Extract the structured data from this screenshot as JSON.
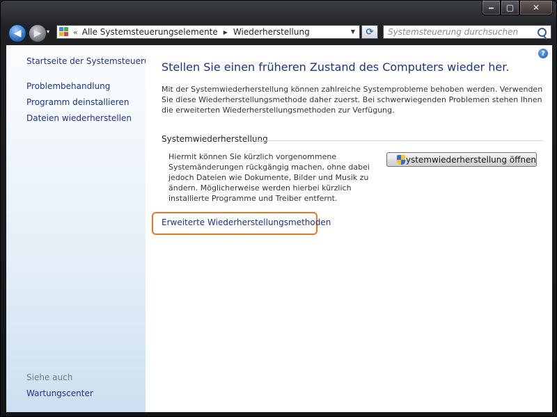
{
  "window": {
    "caption": {
      "minimize": "‒",
      "maximize": "▢",
      "close": "✕"
    }
  },
  "nav": {
    "back_glyph": "◀",
    "forward_glyph": "▶",
    "dropdown_glyph": "▾"
  },
  "address": {
    "overflow": "«",
    "items": [
      "Alle Systemsteuerungselemente",
      "Wiederherstellung"
    ],
    "separator": "▶",
    "dropdown_glyph": "▼"
  },
  "refresh_glyph": "⟳",
  "search": {
    "placeholder": "Systemsteuerung durchsuchen"
  },
  "sidebar": {
    "home": "Startseite der Systemsteuerung",
    "links": [
      "Problembehandlung",
      "Programm deinstallieren",
      "Dateien wiederherstellen"
    ],
    "see_also": "Siehe auch",
    "see_also_links": [
      "Wartungscenter"
    ]
  },
  "main": {
    "help_glyph": "?",
    "heading": "Stellen Sie einen früheren Zustand des Computers wieder her.",
    "intro": "Mit der Systemwiederherstellung können zahlreiche Systemprobleme behoben werden. Verwenden Sie diese Wiederherstellungsmethode daher zuerst. Bei schwerwiegenden Problemen stehen Ihnen die erweiterten Wiederherstellungsmethoden zur Verfügung.",
    "section_title": "Systemwiederherstellung",
    "section_desc": "Hiermit können Sie kürzlich vorgenommene Systemänderungen rückgängig machen, ohne dabei jedoch Dateien wie Dokumente, Bilder und Musik zu ändern. Möglicherweise werden hierbei kürzlich installierte Programme und Treiber entfernt.",
    "open_button": "Systemwiederherstellung öffnen",
    "advanced_link": "Erweiterte Wiederherstellungsmethoden"
  },
  "colors": {
    "link": "#1e3287",
    "highlight": "#ec7421",
    "sidebar_gradient_end": "#cddff1"
  }
}
